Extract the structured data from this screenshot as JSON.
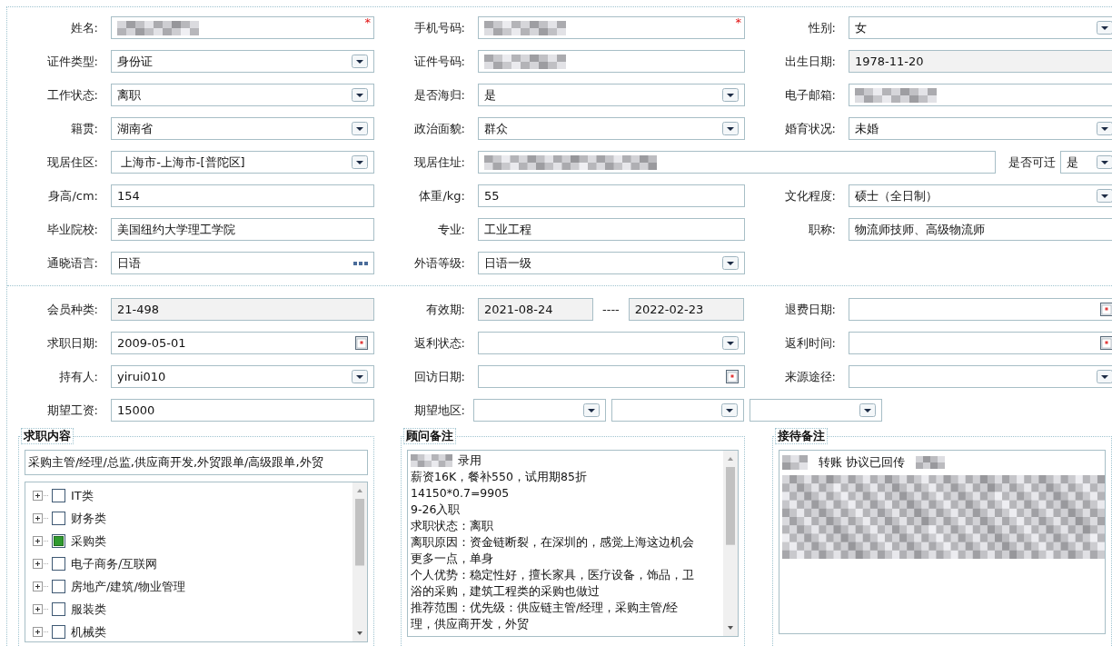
{
  "personal": {
    "rows": [
      [
        {
          "label": "姓名:",
          "kind": "text",
          "redacted": true,
          "required_mark": "*"
        },
        {
          "label": "手机号码:",
          "kind": "text",
          "redacted": true,
          "required_mark": "*"
        },
        {
          "label": "性别:",
          "kind": "select",
          "value": "女"
        }
      ],
      [
        {
          "label": "证件类型:",
          "kind": "select",
          "value": "身份证"
        },
        {
          "label": "证件号码:",
          "kind": "text",
          "redacted": true
        },
        {
          "label": "出生日期:",
          "kind": "readonly",
          "value": "1978-11-20"
        }
      ],
      [
        {
          "label": "工作状态:",
          "kind": "select",
          "value": "离职"
        },
        {
          "label": "是否海归:",
          "kind": "select",
          "value": "是"
        },
        {
          "label": "电子邮箱:",
          "kind": "text",
          "redacted": true
        }
      ],
      [
        {
          "label": "籍贯:",
          "kind": "select",
          "value": "湖南省"
        },
        {
          "label": "政治面貌:",
          "kind": "select",
          "value": "群众"
        },
        {
          "label": "婚育状况:",
          "kind": "select",
          "value": "未婚"
        }
      ],
      [
        {
          "label": "现居住区:",
          "kind": "select",
          "value": " 上海市-上海市-[普陀区]"
        },
        {
          "label": "现居住址:",
          "kind": "address",
          "redacted": true,
          "extra": {
            "label": "是否可迁",
            "value": "是"
          }
        }
      ],
      [
        {
          "label": "身高/cm:",
          "kind": "text",
          "value": "154"
        },
        {
          "label": "体重/kg:",
          "kind": "text",
          "value": "55"
        },
        {
          "label": "文化程度:",
          "kind": "select",
          "value": "硕士（全日制）"
        }
      ],
      [
        {
          "label": "毕业院校:",
          "kind": "text",
          "value": "美国纽约大学理工学院"
        },
        {
          "label": "专业:",
          "kind": "text",
          "value": "工业工程"
        },
        {
          "label": "职称:",
          "kind": "text",
          "value": "物流师技师、高级物流师"
        }
      ],
      [
        {
          "label": "通晓语言:",
          "kind": "lookup",
          "value": "日语"
        },
        {
          "label": "外语等级:",
          "kind": "select",
          "value": "日语一级"
        }
      ]
    ]
  },
  "membership": {
    "rows": [
      [
        {
          "label": "会员种类:",
          "kind": "readonly",
          "value": "21-498"
        },
        {
          "label": "有效期:",
          "kind": "range",
          "from": "2021-08-24",
          "separator": "----",
          "to": "2022-02-23"
        },
        {
          "label": "退费日期:",
          "kind": "date"
        }
      ],
      [
        {
          "label": "求职日期:",
          "kind": "date",
          "value": "2009-05-01"
        },
        {
          "label": "返利状态:",
          "kind": "select"
        },
        {
          "label": "返利时间:",
          "kind": "date"
        }
      ],
      [
        {
          "label": "持有人:",
          "kind": "select",
          "value": "yirui010"
        },
        {
          "label": "回访日期:",
          "kind": "date"
        },
        {
          "label": "来源途径:",
          "kind": "select"
        }
      ],
      [
        {
          "label": "期望工资:",
          "kind": "text",
          "value": "15000"
        },
        {
          "label": "期望地区:",
          "kind": "multi_select"
        }
      ]
    ]
  },
  "job_panel": {
    "title": "求职内容",
    "summary": "采购主管/经理/总监,供应商开发,外贸跟单/高级跟单,外贸",
    "tree": [
      {
        "label": "IT类",
        "checked": false
      },
      {
        "label": "财务类",
        "checked": false
      },
      {
        "label": "采购类",
        "checked": true
      },
      {
        "label": "电子商务/互联网",
        "checked": false
      },
      {
        "label": "房地产/建筑/物业管理",
        "checked": false
      },
      {
        "label": "服装类",
        "checked": false
      },
      {
        "label": "机械类",
        "checked": false
      }
    ]
  },
  "advisor_panel": {
    "title": "顾问备注",
    "lines": [
      {
        "text": "录用",
        "redacted": true
      },
      {
        "text": "薪资16K，餐补550，试用期85折"
      },
      {
        "text": "14150*0.7=9905"
      },
      {
        "text": "9-26入职"
      },
      {
        "text": "求职状态：离职"
      },
      {
        "text": "离职原因：资金链断裂，在深圳的，感觉上海这边机会"
      },
      {
        "text": "更多一点，单身"
      },
      {
        "text": "个人优势：稳定性好，擅长家具，医疗设备，饰品，卫"
      },
      {
        "text": "浴的采购，建筑工程类的采购也做过"
      },
      {
        "text": "推荐范围：优先级：供应链主管/经理，采购主管/经"
      },
      {
        "text": "理，供应商开发，外贸"
      }
    ]
  },
  "reception_panel": {
    "title": "接待备注",
    "first_line": {
      "text": "转账 协议已回传",
      "redacted": true
    }
  }
}
